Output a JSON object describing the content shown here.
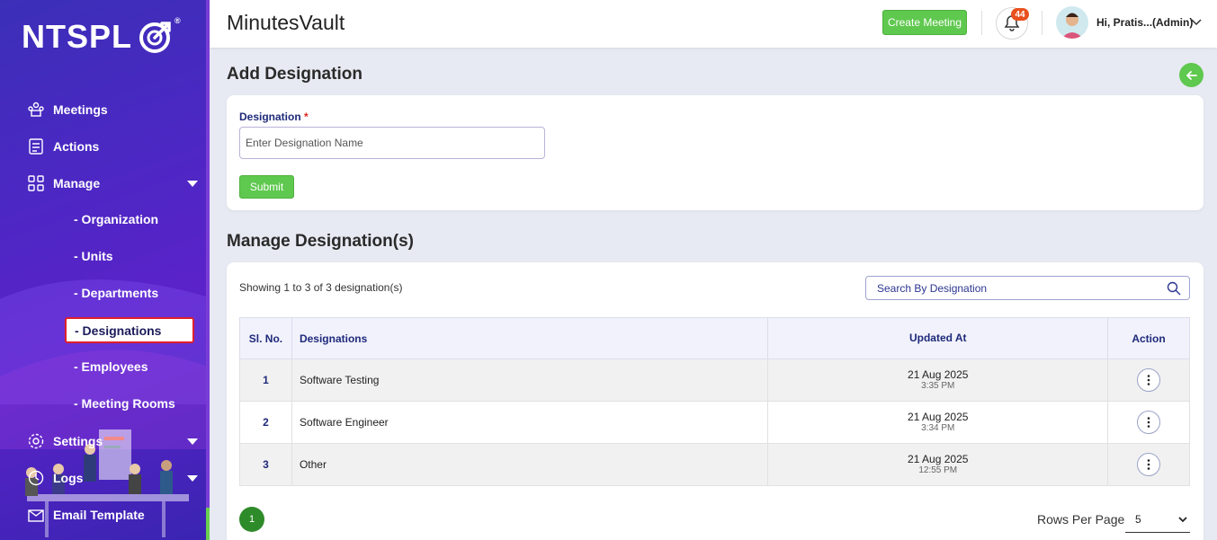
{
  "brand": {
    "logo_text": "NTSPL",
    "registered": "®"
  },
  "sidebar": {
    "items": [
      {
        "label": "Meetings",
        "icon": "meetings-icon"
      },
      {
        "label": "Actions",
        "icon": "actions-icon"
      },
      {
        "label": "Manage",
        "icon": "manage-icon"
      },
      {
        "label": "Settings",
        "icon": "gear-icon"
      },
      {
        "label": "Logs",
        "icon": "clock-icon"
      },
      {
        "label": "Email Template",
        "icon": "mail-icon"
      }
    ],
    "manage_sub": [
      "- Organization",
      "- Units",
      "- Departments",
      "- Designations",
      "- Employees",
      "- Meeting Rooms"
    ]
  },
  "header": {
    "app_title": "MinutesVault",
    "create_meeting": "Create Meeting",
    "notification_count": "44",
    "user_greeting": "Hi, Pratis...(Admin)"
  },
  "add_section": {
    "title": "Add Designation",
    "field_label": "Designation",
    "required_mark": "*",
    "placeholder": "Enter Designation Name",
    "submit": "Submit"
  },
  "manage_section": {
    "title": "Manage Designation(s)",
    "showing": "Showing 1 to 3 of 3 designation(s)",
    "search_placeholder": "Search By Designation",
    "columns": [
      "Sl. No.",
      "Designations",
      "Updated At",
      "Action"
    ],
    "rows": [
      {
        "sl": "1",
        "name": "Software Testing",
        "date": "21 Aug 2025",
        "time": "3:35 PM"
      },
      {
        "sl": "2",
        "name": "Software Engineer",
        "date": "21 Aug 2025",
        "time": "3:34 PM"
      },
      {
        "sl": "3",
        "name": "Other",
        "date": "21 Aug 2025",
        "time": "12:55 PM"
      }
    ],
    "current_page": "1",
    "rows_per_page_label": "Rows Per Page",
    "rows_per_page_value": "5"
  },
  "colors": {
    "accent_green": "#5fc84e",
    "sidebar_purple": "#4d27c4",
    "heading_navy": "#1e2a7a",
    "badge_orange": "#e8501e"
  }
}
